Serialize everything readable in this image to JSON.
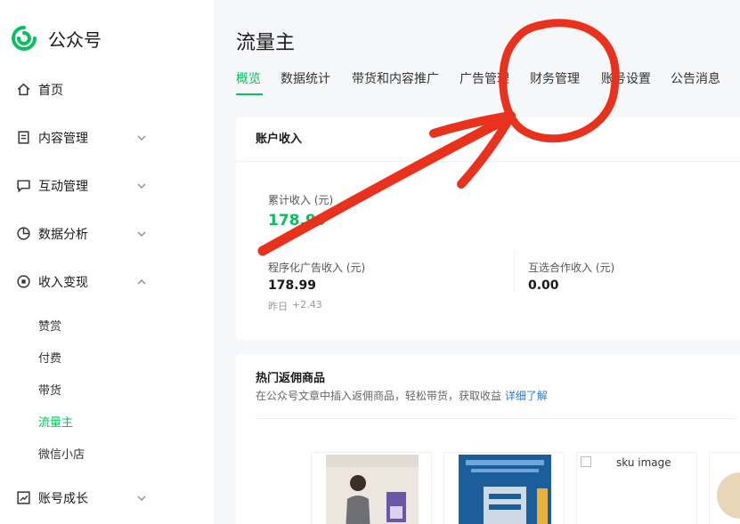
{
  "brand": {
    "name": "公众号"
  },
  "sidebar": {
    "items": [
      {
        "label": "首页",
        "icon": "home-icon"
      },
      {
        "label": "内容管理",
        "icon": "document-icon"
      },
      {
        "label": "互动管理",
        "icon": "chat-icon"
      },
      {
        "label": "数据分析",
        "icon": "pie-chart-icon"
      },
      {
        "label": "收入变现",
        "icon": "coin-icon"
      },
      {
        "label": "账号成长",
        "icon": "growth-icon"
      }
    ],
    "subitems": [
      "赞赏",
      "付费",
      "带货",
      "流量主",
      "微信小店"
    ]
  },
  "page": {
    "title": "流量主"
  },
  "tabs": [
    "概览",
    "数据统计",
    "带货和内容推广",
    "广告管理",
    "财务管理",
    "账号设置",
    "公告消息"
  ],
  "income": {
    "header": "账户收入",
    "total_label": "累计收入 (元)",
    "total_value": "178.99",
    "program_label": "程序化广告收入 (元)",
    "program_value": "178.99",
    "yesterday_label": "昨日",
    "yesterday_change": "+2.43",
    "mutual_label": "互选合作收入 (元)",
    "mutual_value": "0.00"
  },
  "hot": {
    "title": "热门返佣商品",
    "desc": "在公众号文章中插入返佣商品，轻松带货，获取收益",
    "link": "详细了解",
    "sku_alt": "sku image"
  },
  "colors": {
    "accent": "#07c160",
    "link": "#2e7cd8",
    "annotation": "#e8321e"
  }
}
